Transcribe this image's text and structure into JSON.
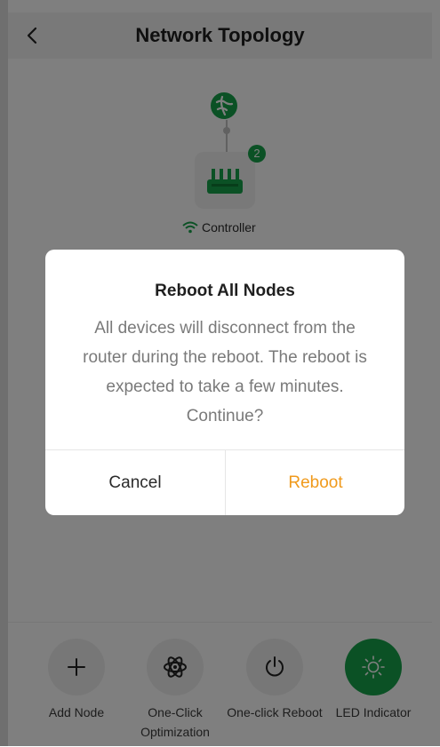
{
  "header": {
    "title": "Network Topology"
  },
  "topology": {
    "node_badge": "2",
    "controller_label": "Controller"
  },
  "actions": [
    {
      "label": "Add Node",
      "icon": "plus-icon"
    },
    {
      "label": "One-Click Optimization",
      "icon": "atom-icon"
    },
    {
      "label": "One-click Reboot",
      "icon": "power-icon"
    },
    {
      "label": "LED Indicator",
      "icon": "sun-icon",
      "active": true
    }
  ],
  "dialog": {
    "title": "Reboot All Nodes",
    "message": "All devices will disconnect from the router during the reboot. The reboot is expected to take a few minutes. Continue?",
    "cancel_label": "Cancel",
    "confirm_label": "Reboot"
  },
  "colors": {
    "accent_green": "#17a34a",
    "confirm_orange": "#f09a1c",
    "overlay": "rgba(0,0,0,0.5)"
  }
}
